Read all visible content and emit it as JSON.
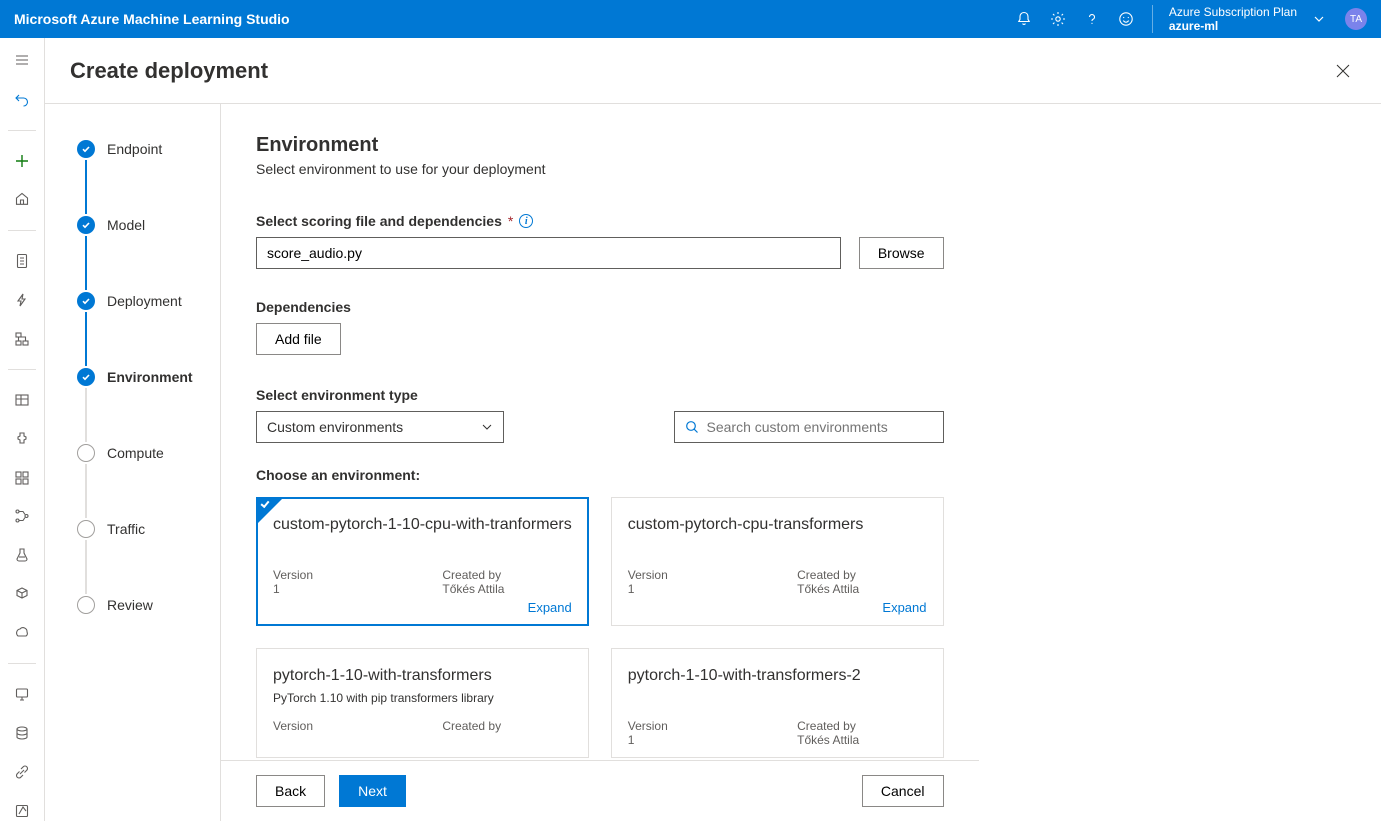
{
  "header": {
    "product": "Microsoft Azure Machine Learning Studio",
    "subscription_label": "Azure Subscription Plan",
    "workspace": "azure-ml",
    "avatar_initials": "TA"
  },
  "panel": {
    "title": "Create deployment"
  },
  "steps": [
    {
      "label": "Endpoint",
      "state": "done"
    },
    {
      "label": "Model",
      "state": "done"
    },
    {
      "label": "Deployment",
      "state": "done"
    },
    {
      "label": "Environment",
      "state": "current"
    },
    {
      "label": "Compute",
      "state": "pending"
    },
    {
      "label": "Traffic",
      "state": "pending"
    },
    {
      "label": "Review",
      "state": "pending"
    }
  ],
  "section": {
    "title": "Environment",
    "subtitle": "Select environment to use for your deployment"
  },
  "scoring": {
    "label": "Select scoring file and dependencies",
    "value": "score_audio.py",
    "browse": "Browse"
  },
  "dependencies": {
    "label": "Dependencies",
    "add_file": "Add file"
  },
  "env_type": {
    "label": "Select environment type",
    "value": "Custom environments"
  },
  "search": {
    "placeholder": "Search custom environments"
  },
  "choose_env_label": "Choose an environment:",
  "meta_labels": {
    "version": "Version",
    "created_by": "Created by",
    "expand": "Expand"
  },
  "environments": [
    {
      "name": "custom-pytorch-1-10-cpu-with-tranformers",
      "desc": "",
      "version": "1",
      "created_by": "Tőkés Attila",
      "selected": true,
      "show_expand": true
    },
    {
      "name": "custom-pytorch-cpu-transformers",
      "desc": "",
      "version": "1",
      "created_by": "Tőkés Attila",
      "selected": false,
      "show_expand": true
    },
    {
      "name": "pytorch-1-10-with-transformers",
      "desc": "PyTorch 1.10 with pip transformers library",
      "version": "",
      "created_by": "",
      "selected": false,
      "show_expand": false
    },
    {
      "name": "pytorch-1-10-with-transformers-2",
      "desc": "",
      "version": "1",
      "created_by": "Tőkés Attila",
      "selected": false,
      "show_expand": false
    }
  ],
  "footer": {
    "back": "Back",
    "next": "Next",
    "cancel": "Cancel"
  }
}
